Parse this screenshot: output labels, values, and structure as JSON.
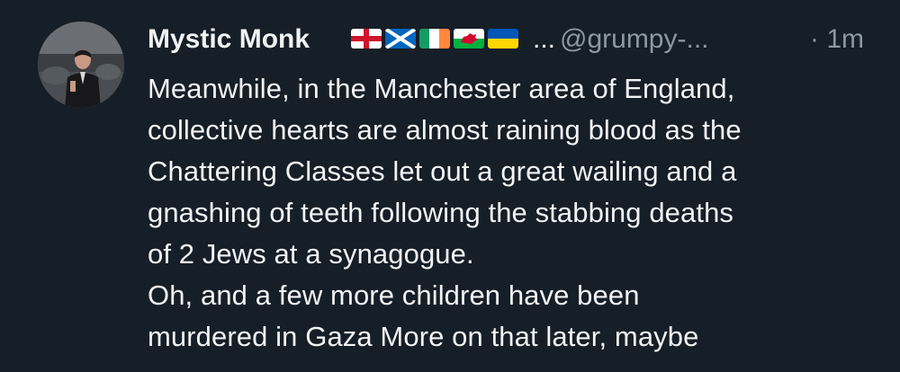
{
  "post": {
    "author_name": "Mystic Monk",
    "flags": [
      {
        "icon": "england-flag-icon"
      },
      {
        "icon": "scotland-flag-icon"
      },
      {
        "icon": "ireland-flag-icon"
      },
      {
        "icon": "wales-flag-icon"
      },
      {
        "icon": "ukraine-flag-icon"
      }
    ],
    "name_truncation": "...",
    "handle": "@grumpy-...",
    "time": "· 1m",
    "text_lines": [
      "Meanwhile, in the Manchester area of England,",
      "collective hearts are almost raining blood as the",
      "Chattering Classes let out a great wailing and a",
      "gnashing of teeth following the stabbing deaths",
      "of 2 Jews at a synagogue.",
      "Oh, and a few more children have been",
      "murdered in Gaza More on that later, maybe"
    ]
  },
  "colors": {
    "background": "#161e27",
    "text_primary": "#f1f3f5",
    "text_secondary": "#8b98a5"
  }
}
